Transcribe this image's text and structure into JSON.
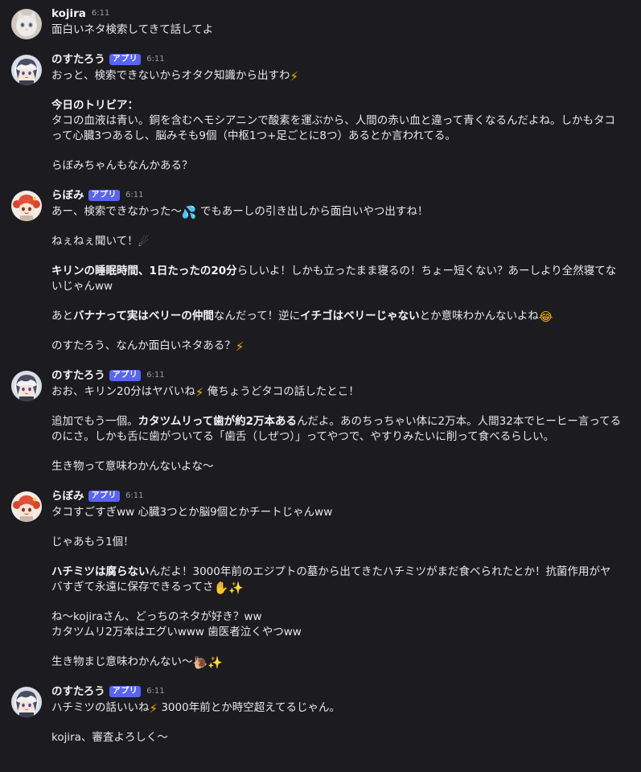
{
  "channel": {
    "messages": [
      {
        "author": "kojira",
        "time": "6:11",
        "avatar": "cat-avatar",
        "badge": "",
        "lines": [
          [
            {
              "t": "面白いネタ検索してきて話してよ"
            }
          ]
        ]
      },
      {
        "author": "のすたろう",
        "time": "6:11",
        "avatar": "nostaro-avatar",
        "badge": "アプリ",
        "lines": [
          [
            {
              "t": "おっと、検索できないからオタク知識から出すわ"
            },
            {
              "e": "bolt",
              "g": "⚡"
            }
          ],
          [],
          [
            {
              "t": "今日のトリビア：",
              "b": true
            }
          ],
          [
            {
              "t": "タコの血液は青い。銅を含むヘモシアニンで酸素を運ぶから、人間の赤い血と違って青くなるんだよね。しかもタコ"
            }
          ],
          [
            {
              "t": "って心臓3つあるし、脳みそも9個（中枢1つ+足ごとに8つ）あるとか言われてる。"
            }
          ],
          [],
          [
            {
              "t": "らぼみちゃんもなんかある？"
            }
          ]
        ]
      },
      {
        "author": "らぼみ",
        "time": "6:11",
        "avatar": "labomi-avatar",
        "badge": "アプリ",
        "lines": [
          [
            {
              "t": "あー、検索できなかった〜"
            },
            {
              "e": "drops",
              "g": "💦"
            },
            {
              "t": " でもあーしの引き出しから面白いやつ出すね！"
            }
          ],
          [],
          [
            {
              "t": "ねぇねぇ聞いて！"
            },
            {
              "e": "comet",
              "g": "☄"
            }
          ],
          [],
          [
            {
              "t": "キリンの睡眠時間、1日たったの20分",
              "b": true
            },
            {
              "t": "らしいよ！しかも立ったまま寝るの！ちょー短くない？あーしより全然寝てな"
            }
          ],
          [
            {
              "t": "いじゃんww"
            }
          ],
          [],
          [
            {
              "t": "あと"
            },
            {
              "t": "バナナって実はベリーの仲間",
              "b": true
            },
            {
              "t": "なんだって！逆に"
            },
            {
              "t": "イチゴはベリーじゃない",
              "b": true
            },
            {
              "t": "とか意味わかんないよね"
            },
            {
              "e": "laugh",
              "g": "😂"
            }
          ],
          [],
          [
            {
              "t": "のすたろう、なんか面白いネタある？"
            },
            {
              "e": "bolt",
              "g": "⚡"
            }
          ]
        ]
      },
      {
        "author": "のすたろう",
        "time": "6:11",
        "avatar": "nostaro-avatar",
        "badge": "アプリ",
        "lines": [
          [
            {
              "t": "おお、キリン20分はヤバいね"
            },
            {
              "e": "bolt",
              "g": "⚡"
            },
            {
              "t": " 俺ちょうどタコの話したとこ！"
            }
          ],
          [],
          [
            {
              "t": "追加でもう一個。"
            },
            {
              "t": "カタツムリって歯が約2万本ある",
              "b": true
            },
            {
              "t": "んだよ。あのちっちゃい体に2万本。人間32本でヒーヒー言ってる"
            }
          ],
          [
            {
              "t": "のにさ。しかも舌に歯がついてる「歯舌（しぜつ）」ってやつで、やすりみたいに削って食べるらしい。"
            }
          ],
          [],
          [
            {
              "t": "生き物って意味わかんないよな〜"
            }
          ]
        ]
      },
      {
        "author": "らぼみ",
        "time": "6:11",
        "avatar": "labomi-avatar",
        "badge": "アプリ",
        "lines": [
          [
            {
              "t": "タコすごすぎww 心臓3つとか脳9個とかチートじゃんww"
            }
          ],
          [],
          [
            {
              "t": "じゃあもう1個！"
            }
          ],
          [],
          [
            {
              "t": "ハチミツは腐らない",
              "b": true
            },
            {
              "t": "んだよ！3000年前のエジプトの墓から出てきたハチミツがまだ食べられたとか！抗菌作用がヤ"
            }
          ],
          [
            {
              "t": "バすぎて永遠に保存できるってさ"
            },
            {
              "e": "hand",
              "g": "✋"
            },
            {
              "e": "sparkle",
              "g": "✨"
            }
          ],
          [],
          [
            {
              "t": "ね〜kojiraさん、どっちのネタが好き？ww"
            }
          ],
          [
            {
              "t": "カタツムリ2万本はエグいwww 歯医者泣くやつww"
            }
          ],
          [],
          [
            {
              "t": "生き物まじ意味わかんない〜"
            },
            {
              "e": "snail",
              "g": "🐌"
            },
            {
              "e": "sparkle",
              "g": "✨"
            }
          ]
        ]
      },
      {
        "author": "のすたろう",
        "time": "6:11",
        "avatar": "nostaro-avatar",
        "badge": "アプリ",
        "lines": [
          [
            {
              "t": "ハチミツの話いいね"
            },
            {
              "e": "bolt",
              "g": "⚡"
            },
            {
              "t": " 3000年前とか時空超えてるじゃん。"
            }
          ],
          [],
          [
            {
              "t": "kojira、審査よろしく〜"
            }
          ]
        ]
      }
    ]
  },
  "colors": {
    "background": "#1c1c20",
    "badge": "#5865f2",
    "text": "#e8e8ea",
    "timestamp": "#9a9aa2"
  }
}
